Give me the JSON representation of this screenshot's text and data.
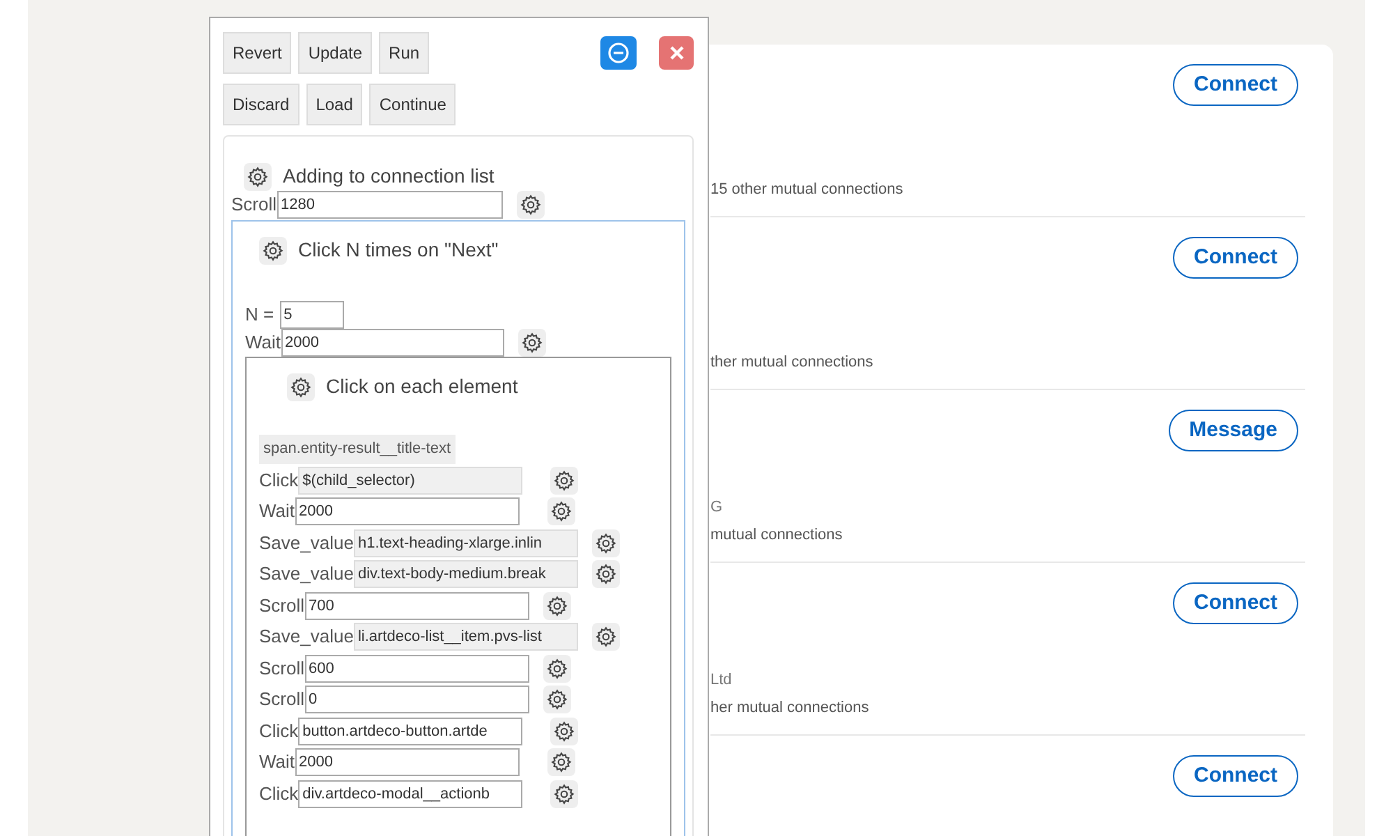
{
  "results": [
    {
      "mutual": "15 other mutual connections",
      "action": "Connect"
    },
    {
      "mutual": "ther mutual connections",
      "action": "Connect"
    },
    {
      "subtitle": "G",
      "mutual": "mutual connections",
      "action": "Message"
    },
    {
      "subtitle": "Ltd",
      "mutual": "her mutual connections",
      "action": "Connect"
    },
    {
      "action": "Connect"
    }
  ],
  "panel": {
    "buttons": [
      [
        "Revert",
        "Update",
        "Run"
      ],
      [
        "Discard",
        "Load",
        "Continue"
      ]
    ],
    "block": {
      "title": "Adding to connection list",
      "fields": [
        {
          "label": "Scroll",
          "value": "1280",
          "disabled": false
        }
      ],
      "child": {
        "title": "Click N times on \"Next\"",
        "fields": [
          {
            "label": "N =",
            "value": "5",
            "disabled": false,
            "gear": false
          },
          {
            "label": "Wait",
            "value": "2000",
            "disabled": false,
            "gear": true
          }
        ],
        "child": {
          "title": "Click on each element",
          "selector": "span.entity-result__title-text",
          "steps": [
            {
              "label": "Click",
              "value": "$(child_selector)",
              "disabled": true
            },
            {
              "label": "Wait",
              "value": "2000",
              "disabled": false
            },
            {
              "label": "Save_value",
              "value": "h1.text-heading-xlarge.inlin",
              "disabled": true
            },
            {
              "label": "Save_value",
              "value": "div.text-body-medium.break",
              "disabled": true
            },
            {
              "label": "Scroll",
              "value": "700",
              "disabled": false
            },
            {
              "label": "Save_value",
              "value": "li.artdeco-list__item.pvs-list",
              "disabled": true
            },
            {
              "label": "Scroll",
              "value": "600",
              "disabled": false
            },
            {
              "label": "Scroll",
              "value": "0",
              "disabled": false
            },
            {
              "label": "Click",
              "value": "button.artdeco-button.artde",
              "disabled": false
            },
            {
              "label": "Wait",
              "value": "2000",
              "disabled": false
            },
            {
              "label": "Click",
              "value": "div.artdeco-modal__actionb",
              "disabled": false
            }
          ]
        }
      }
    }
  }
}
